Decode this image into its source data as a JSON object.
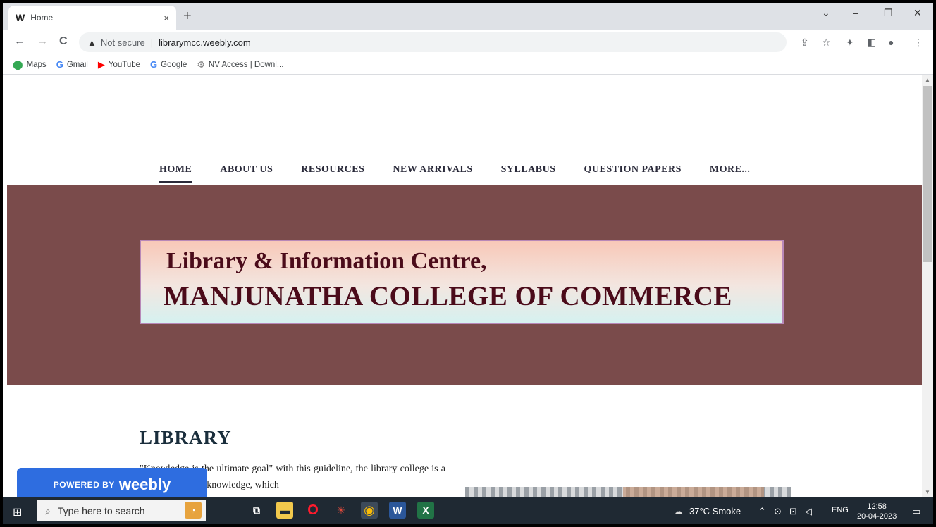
{
  "browser": {
    "tab": {
      "favicon": "W",
      "title": "Home",
      "close": "×"
    },
    "new_tab": "+",
    "window_controls": {
      "dropdown": "⌄",
      "minimize": "–",
      "restore": "❐",
      "close": "✕"
    },
    "nav": {
      "back": "←",
      "forward": "→",
      "reload": "C"
    },
    "address": {
      "security_label": "Not secure",
      "url": "librarymcc.weebly.com"
    },
    "toolbar_icons": [
      "share-icon",
      "star-icon",
      "extensions-icon",
      "sidepanel-icon",
      "profile-icon",
      "menu-icon"
    ],
    "bookmarks": [
      {
        "icon": "📍",
        "label": "Maps",
        "color": "#34a853"
      },
      {
        "icon": "G",
        "label": "Gmail",
        "color": "#4285f4"
      },
      {
        "icon": "▶",
        "label": "YouTube",
        "color": "#ff0000"
      },
      {
        "icon": "G",
        "label": "Google",
        "color": "#4285f4"
      },
      {
        "icon": "⚙",
        "label": "NV Access | Downl...",
        "color": "#888888"
      }
    ]
  },
  "site": {
    "nav": [
      "HOME",
      "ABOUT US",
      "RESOURCES",
      "NEW ARRIVALS",
      "SYLLABUS",
      "QUESTION PAPERS",
      "MORE..."
    ],
    "banner": {
      "line1": "Library & Information Centre,",
      "line2": "MANJUNATHA COLLEGE OF COMMERCE"
    },
    "heading": "LIBRARY",
    "paragraph": "\"Knowledge is the ultimate goal\" with this guideline, the library college is a treasure trove of knowledge, which",
    "weebly": {
      "powered_by": "POWERED BY",
      "brand": "weebly"
    }
  },
  "taskbar": {
    "search_placeholder": "Type here to search",
    "weather": "37°C  Smoke",
    "lang": "ENG",
    "time": "12:58",
    "date": "20-04-2023"
  },
  "colors": {
    "banner_bg": "#7a4b4b",
    "banner_text": "#4b0b1a",
    "weebly_blue": "#2e6de0"
  }
}
